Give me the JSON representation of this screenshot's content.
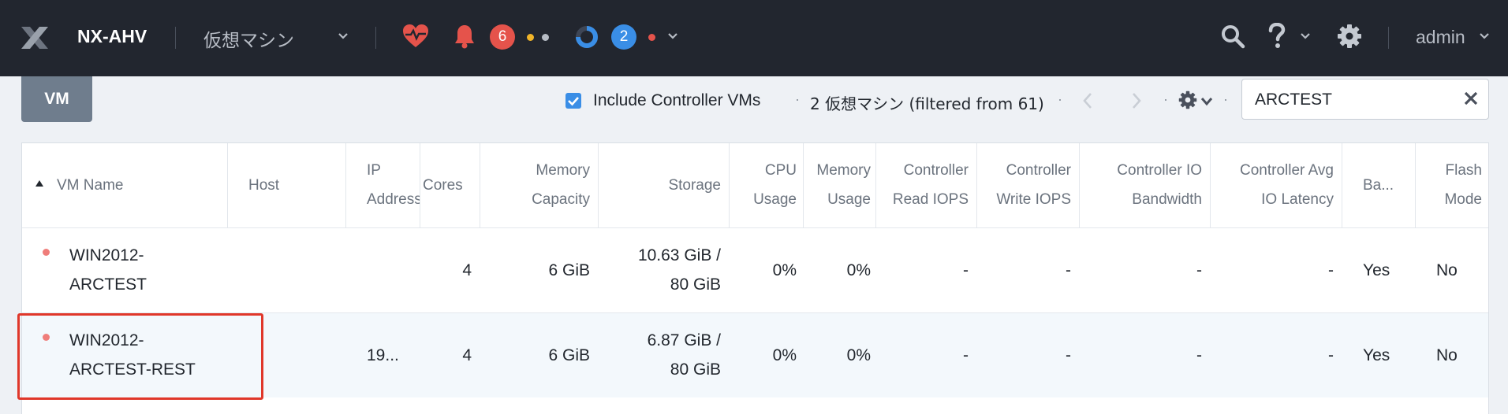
{
  "topbar": {
    "cluster_name": "NX-AHV",
    "entity_selector": "仮想マシン",
    "alerts_count": "6",
    "tasks_count": "2",
    "user": "admin",
    "colors": {
      "alert_red": "#e5534b",
      "task_blue": "#3a8ee6",
      "warning_yellow": "#f0b429"
    }
  },
  "toolbar": {
    "view_tab": "VM",
    "include_cvm_label": "Include Controller VMs",
    "count_text": "2 仮想マシン (filtered from 61)",
    "search_value": "ARCTEST"
  },
  "table": {
    "headers": {
      "vm_name": "VM Name",
      "host": "Host",
      "ip1": "IP",
      "ip2": "Address",
      "cores": "Cores",
      "mem1": "Memory",
      "mem2": "Capacity",
      "storage": "Storage",
      "cpu1": "CPU",
      "cpu2": "Usage",
      "memu1": "Memory",
      "memu2": "Usage",
      "cr1": "Controller",
      "cr2": "Read IOPS",
      "cw1": "Controller",
      "cw2": "Write IOPS",
      "cb1": "Controller IO",
      "cb2": "Bandwidth",
      "cl1": "Controller Avg",
      "cl2": "IO Latency",
      "backup": "Ba...",
      "flash1": "Flash",
      "flash2": "Mode"
    },
    "rows": [
      {
        "name1": "WIN2012-",
        "name2": "ARCTEST",
        "host": "",
        "ip": "",
        "cores": "4",
        "memory": "6 GiB",
        "storage1": "10.63 GiB /",
        "storage2": "80 GiB",
        "cpu": "0%",
        "mem_usage": "0%",
        "read_iops": "-",
        "write_iops": "-",
        "io_bw": "-",
        "io_lat": "-",
        "backup": "Yes",
        "flash": "No"
      },
      {
        "name1": "WIN2012-",
        "name2": "ARCTEST-REST",
        "host": "",
        "ip": "19...",
        "cores": "4",
        "memory": "6 GiB",
        "storage1": "6.87 GiB /",
        "storage2": "80 GiB",
        "cpu": "0%",
        "mem_usage": "0%",
        "read_iops": "-",
        "write_iops": "-",
        "io_bw": "-",
        "io_lat": "-",
        "backup": "Yes",
        "flash": "No"
      }
    ]
  }
}
